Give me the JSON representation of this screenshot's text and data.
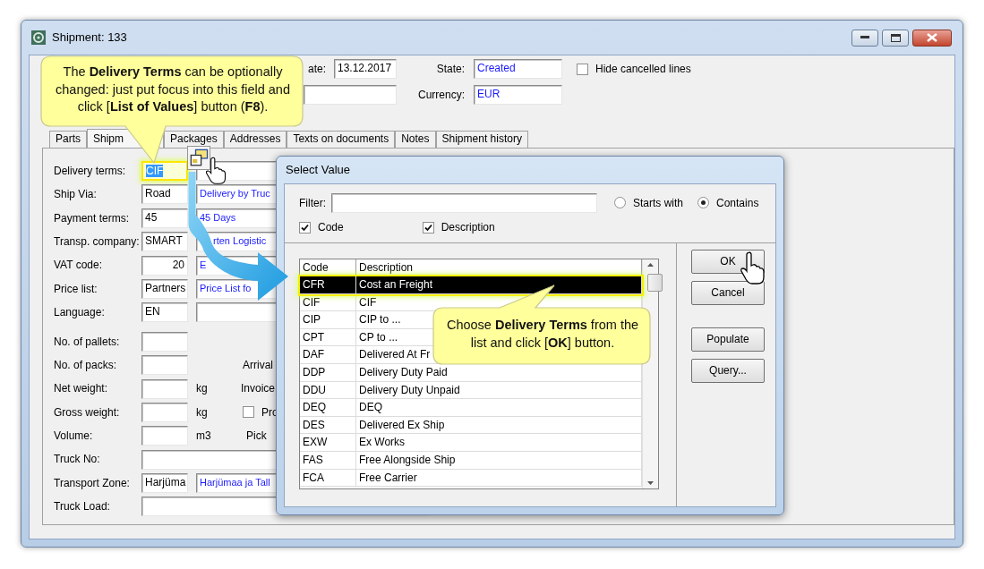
{
  "window": {
    "title": "Shipment: 133"
  },
  "header": {
    "date_label": "ate:",
    "date": "13.12.2017",
    "state_label": "State:",
    "state": "Created",
    "currency_label": "Currency:",
    "currency": "EUR",
    "hide_cancelled": {
      "label": "Hide cancelled lines",
      "checked": false
    }
  },
  "tabs": [
    {
      "label": "Parts",
      "selected": false
    },
    {
      "label": "Shipm",
      "selected": true
    },
    {
      "label": "Packages",
      "selected": false
    },
    {
      "label": "Addresses",
      "selected": false
    },
    {
      "label": "Texts on documents",
      "selected": false
    },
    {
      "label": "Notes",
      "selected": false
    },
    {
      "label": "Shipment history",
      "selected": false
    }
  ],
  "form_sections": [
    [
      {
        "kind": "lookup",
        "label": "Delivery terms:",
        "code": "CIF",
        "focused": true
      },
      {
        "kind": "lookup",
        "label": "Ship Via:",
        "code": "Road",
        "description": "Delivery by Truc",
        "focused": false
      },
      {
        "kind": "lookup",
        "label": "Payment terms:",
        "code": "45",
        "description": "45 Days",
        "focused": false
      },
      {
        "kind": "lookup",
        "label": "Transp. company:",
        "code": "SMART",
        "description": "rten Logistic",
        "focused": false
      },
      {
        "kind": "number",
        "label": "VAT code:",
        "code": "20",
        "description": "E",
        "focused": false
      },
      {
        "kind": "lookup",
        "label": "Price list:",
        "code": "Partners",
        "description": "Price List fo",
        "focused": false
      },
      {
        "kind": "lookup",
        "label": "Language:",
        "code": "EN",
        "focused": false
      }
    ],
    [
      {
        "kind": "short",
        "label": "No. of pallets:"
      },
      {
        "kind": "short",
        "label": "No. of packs:",
        "side": {
          "kind": "text",
          "label": "Arrival"
        }
      },
      {
        "kind": "short",
        "label": "Net weight:",
        "unit": "kg",
        "side": {
          "kind": "text",
          "label": "Invoice"
        }
      },
      {
        "kind": "short",
        "label": "Gross weight:",
        "unit": "kg",
        "side": {
          "kind": "checkbox",
          "label": "Pro",
          "checked": false
        }
      },
      {
        "kind": "short",
        "label": "Volume:",
        "unit": "m3",
        "side": {
          "kind": "text",
          "label": "Pick"
        }
      },
      {
        "kind": "wide",
        "label": "Truck No:"
      },
      {
        "kind": "lookup",
        "label": "Transport Zone:",
        "code": "Harjüma",
        "description": "Harjümaa ja Tall",
        "focused": false
      },
      {
        "kind": "wide",
        "label": "Truck Load:"
      }
    ]
  ],
  "dialog": {
    "title": "Select Value",
    "filter_label": "Filter:",
    "match_modes": [
      {
        "label": "Starts with",
        "selected": false
      },
      {
        "label": "Contains",
        "selected": true
      }
    ],
    "search_in": [
      {
        "label": "Code",
        "checked": true
      },
      {
        "label": "Description",
        "checked": true
      }
    ],
    "columns": [
      "Code",
      "Description"
    ],
    "rows": [
      {
        "code": "CFR",
        "description": "Cost an Freight",
        "selected": true
      },
      {
        "code": "CIF",
        "description": "CIF",
        "selected": false
      },
      {
        "code": "CIP",
        "description": "CIP to ...",
        "selected": false
      },
      {
        "code": "CPT",
        "description": "CP to ...",
        "selected": false
      },
      {
        "code": "DAF",
        "description": "Delivered At Fr",
        "selected": false
      },
      {
        "code": "DDP",
        "description": "Delivery Duty Paid",
        "selected": false
      },
      {
        "code": "DDU",
        "description": "Delivery Duty Unpaid",
        "selected": false
      },
      {
        "code": "DEQ",
        "description": "DEQ",
        "selected": false
      },
      {
        "code": "DES",
        "description": "Delivered Ex Ship",
        "selected": false
      },
      {
        "code": "EXW",
        "description": "Ex Works",
        "selected": false
      },
      {
        "code": "FAS",
        "description": "Free Alongside Ship",
        "selected": false
      },
      {
        "code": "FCA",
        "description": "Free Carrier",
        "selected": false
      }
    ],
    "button_groups": [
      [
        "OK",
        "Cancel"
      ],
      [
        "Populate",
        "Query..."
      ]
    ]
  },
  "callouts": [
    {
      "text": "The **Delivery Terms** can be optionally changed: just put focus into this field and click [**List of Values**] button (**F8**)."
    },
    {
      "text": "Choose **Delivery Terms** from the list and click [**OK**] button."
    }
  ]
}
